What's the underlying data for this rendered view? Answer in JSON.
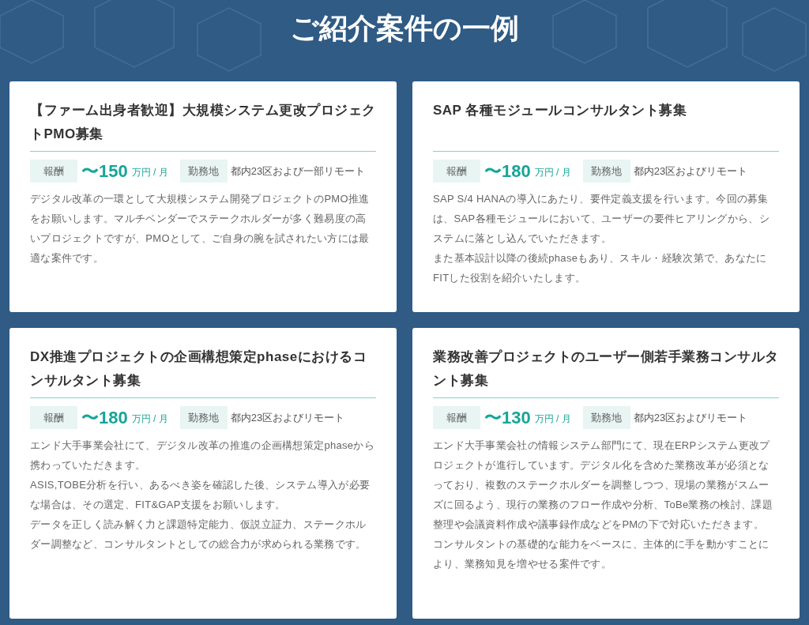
{
  "heading": "ご紹介案件の一例",
  "cards": [
    {
      "title": "【ファーム出身者歓迎】大規模システム更改プロジェクトPMO募集",
      "pay_label": "報酬",
      "pay_amount": "〜150",
      "pay_unit": "万円 / 月",
      "location_label": "勤務地",
      "location": "都内23区および一部リモート",
      "description": [
        "デジタル改革の一環として大規模システム開発プロジェクトのPMO推進をお願いします。マルチベンダーでステークホルダーが多く難易度の高いプロジェクトですが、PMOとして、ご自身の腕を試されたい方には最適な案件です。"
      ]
    },
    {
      "title": "SAP 各種モジュールコンサルタント募集",
      "pay_label": "報酬",
      "pay_amount": "〜180",
      "pay_unit": "万円 / 月",
      "location_label": "勤務地",
      "location": "都内23区およびリモート",
      "description": [
        "SAP S/4 HANAの導入にあたり、要件定義支援を行います。今回の募集は、SAP各種モジュールにおいて、ユーザーの要件ヒアリングから、システムに落とし込んでいただきます。",
        "また基本設計以降の後続phaseもあり、スキル・経験次第で、あなたにFITした役割を紹介いたします。"
      ]
    },
    {
      "title": "DX推進プロジェクトの企画構想策定phaseにおけるコンサルタント募集",
      "pay_label": "報酬",
      "pay_amount": "〜180",
      "pay_unit": "万円 / 月",
      "location_label": "勤務地",
      "location": "都内23区およびリモート",
      "description": [
        "エンド大手事業会社にて、デジタル改革の推進の企画構想策定phaseから携わっていただきます。",
        "ASIS,TOBE分析を行い、あるべき姿を確認した後、システム導入が必要な場合は、その選定、FIT&GAP支援をお願いします。",
        "データを正しく読み解く力と課題特定能力、仮説立証力、ステークホルダー調整など、コンサルタントとしての総合力が求められる業務です。"
      ]
    },
    {
      "title": "業務改善プロジェクトのユーザー側若手業務コンサルタント募集",
      "pay_label": "報酬",
      "pay_amount": "〜130",
      "pay_unit": "万円 / 月",
      "location_label": "勤務地",
      "location": "都内23区およびリモート",
      "description": [
        "エンド大手事業会社の情報システム部門にて、現在ERPシステム更改プロジェクトが進行しています。デジタル化を含めた業務改革が必須となっており、複数のステークホルダーを調整しつつ、現場の業務がスムーズに回るよう、現行の業務のフロー作成や分析、ToBe業務の検討、課題整理や会議資料作成や議事録作成などをPMの下で対応いただきます。",
        "コンサルタントの基礎的な能力をベースに、主体的に手を動かすことにより、業務知見を増やせる案件です。"
      ]
    }
  ]
}
